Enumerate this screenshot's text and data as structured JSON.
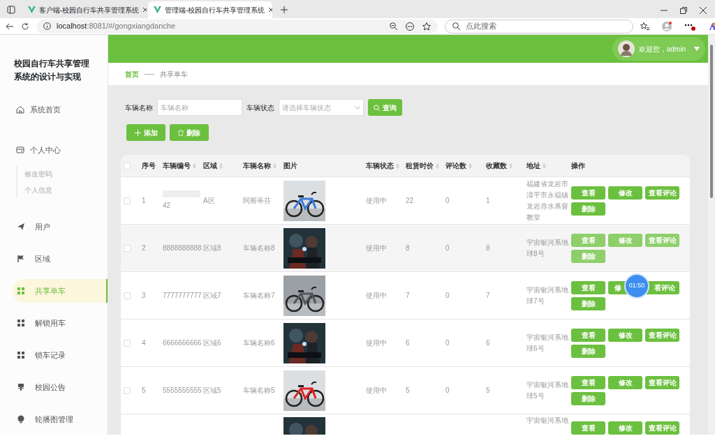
{
  "browser": {
    "tabs": [
      {
        "title": "客户端-校园自行车共享管理系统",
        "selected": false
      },
      {
        "title": "管理端-校园自行车共享管理系统",
        "selected": true
      }
    ],
    "address": {
      "host": "localhost",
      "rest": ":8081/#/gongxiangdanche"
    },
    "search": {
      "placeholder": "点此搜索"
    }
  },
  "sidebar": {
    "title": "校园自行车共享管理系统的设计与实现",
    "items": [
      {
        "label": "系统首页",
        "selected": false
      },
      {
        "label": "个人中心",
        "selected": false,
        "children": [
          {
            "label": "修改密码"
          },
          {
            "label": "个人信息"
          }
        ]
      },
      {
        "label": "用户",
        "selected": false
      },
      {
        "label": "区域",
        "selected": false
      },
      {
        "label": "共享单车",
        "selected": true
      },
      {
        "label": "解锁用车",
        "selected": false
      },
      {
        "label": "锁车记录",
        "selected": false
      },
      {
        "label": "校园公告",
        "selected": false
      },
      {
        "label": "轮播图管理",
        "selected": false
      }
    ]
  },
  "header": {
    "greeting": "欢迎您，admin"
  },
  "breadcrumb": [
    "首页",
    "共享单车"
  ],
  "filters": [
    {
      "label": "车辆名称",
      "placeholder": "车辆名称",
      "kind": "input"
    },
    {
      "label": "车辆状态",
      "placeholder": "请选择车辆状态",
      "kind": "select"
    }
  ],
  "search_button": "查询",
  "add_button": "添加",
  "delete_button": "删除",
  "table": {
    "select_all_checked": false,
    "columns": [
      {
        "label": "序号",
        "sortable": false
      },
      {
        "label": "车辆编号",
        "sortable": true
      },
      {
        "label": "区域",
        "sortable": true
      },
      {
        "label": "车辆名称",
        "sortable": true
      },
      {
        "label": "图片",
        "sortable": false
      },
      {
        "label": "车辆状态",
        "sortable": true
      },
      {
        "label": "租赁时价",
        "sortable": true
      },
      {
        "label": "评论数",
        "sortable": true
      },
      {
        "label": "收藏数",
        "sortable": true
      },
      {
        "label": "地址",
        "sortable": true
      },
      {
        "label": "操作",
        "sortable": false
      }
    ],
    "rows": [
      {
        "checked": false,
        "hovered": false,
        "cells": [
          "1",
          "42",
          "A区",
          "阿斯蒂芬",
          "",
          "使用中",
          "22",
          "0",
          "1",
          "福建省龙岩市漳平市永福镇龙岩赤水基督教堂"
        ],
        "actions": [
          "查看",
          "修改",
          "查看评论",
          "删除"
        ]
      },
      {
        "checked": false,
        "hovered": true,
        "cells": [
          "2",
          "8888888888",
          "区域8",
          "车辆名称8",
          "",
          "使用中",
          "8",
          "0",
          "8",
          "宇宙银河系地球8号"
        ],
        "actions": [
          "查看",
          "修改",
          "查看评论",
          "删除"
        ]
      },
      {
        "checked": false,
        "hovered": false,
        "cells": [
          "3",
          "7777777777",
          "区域7",
          "车辆名称7",
          "",
          "使用中",
          "7",
          "0",
          "7",
          "宇宙银河系地球7号"
        ],
        "actions": [
          "查看",
          "修",
          "看评论",
          "删除"
        ]
      },
      {
        "checked": false,
        "hovered": false,
        "cells": [
          "4",
          "6666666666",
          "区域6",
          "车辆名称6",
          "",
          "使用中",
          "6",
          "0",
          "6",
          "宇宙银河系地球6号"
        ],
        "actions": [
          "查看",
          "修改",
          "查看评论",
          "删除"
        ]
      },
      {
        "checked": false,
        "hovered": false,
        "cells": [
          "5",
          "5555555555",
          "区域5",
          "车辆名称5",
          "",
          "使用中",
          "5",
          "0",
          "5",
          "宇宙银河系地球5号"
        ],
        "actions": [
          "查看",
          "修改",
          "查看评论",
          "删除"
        ]
      },
      {
        "hovered": false,
        "cells": [
          "",
          "",
          "",
          "",
          "",
          "",
          "",
          "",
          "",
          "宇宙银河系地"
        ],
        "actions": [
          "查看",
          "修改",
          "查看评论"
        ]
      }
    ]
  },
  "timer": "01:50"
}
